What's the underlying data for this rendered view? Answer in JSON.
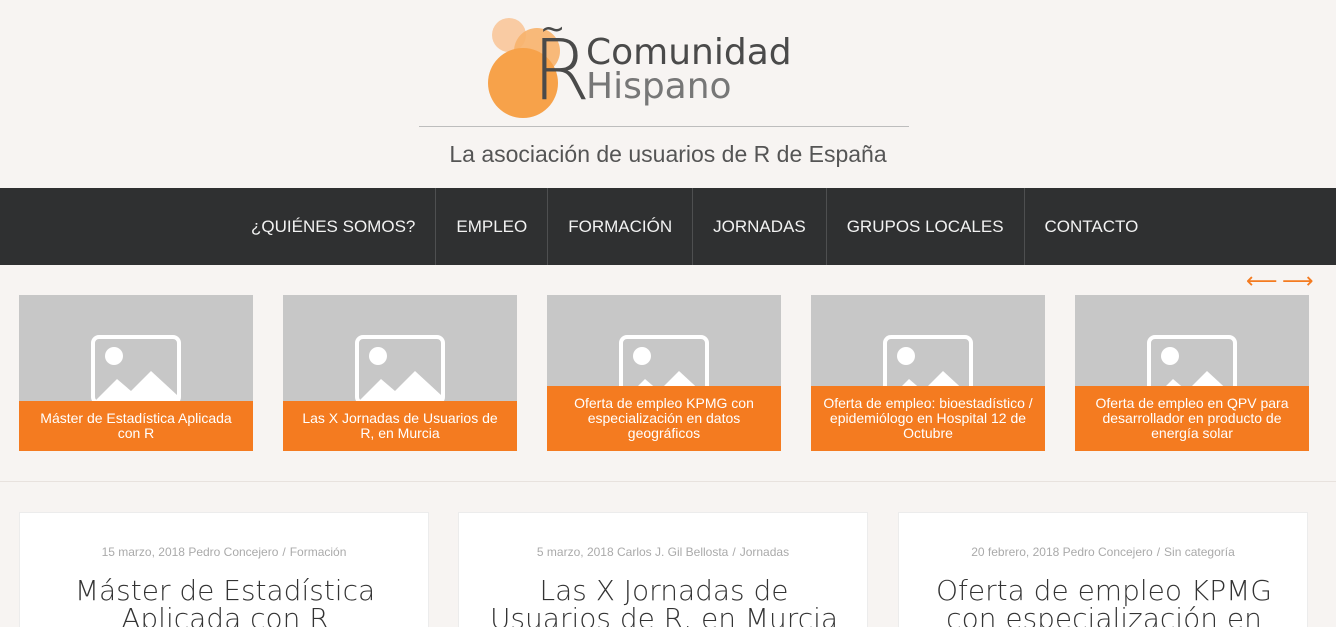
{
  "site": {
    "logo": {
      "title_line1": "Comunidad",
      "title_line2": "Hispano",
      "mark_letter": "R",
      "mark_accent": "~"
    },
    "tagline": "La asociación de usuarios de R de España"
  },
  "nav": {
    "items": [
      {
        "label": "¿QUIÉNES SOMOS?"
      },
      {
        "label": "EMPLEO"
      },
      {
        "label": "FORMACIÓN"
      },
      {
        "label": "JORNADAS"
      },
      {
        "label": "GRUPOS LOCALES"
      },
      {
        "label": "CONTACTO"
      }
    ]
  },
  "carousel": {
    "arrow_prev": "⟵",
    "arrow_next": "⟶",
    "items": [
      {
        "caption": "Máster de Estadística Aplicada con R"
      },
      {
        "caption": "Las X Jornadas de Usuarios de R, en Murcia"
      },
      {
        "caption": "Oferta de empleo KPMG con especialización en datos geográficos"
      },
      {
        "caption": "Oferta de empleo: bioestadístico / epidemiólogo en Hospital 12 de Octubre"
      },
      {
        "caption": "Oferta de empleo en QPV para desarrollador en producto de energía solar"
      }
    ]
  },
  "posts": [
    {
      "date": "15 marzo, 2018",
      "author": "Pedro Concejero",
      "category": "Formación",
      "title": "Máster de Estadística Aplicada con R"
    },
    {
      "date": "5 marzo, 2018",
      "author": "Carlos J. Gil Bellosta",
      "category": "Jornadas",
      "title": "Las X Jornadas de Usuarios de R, en Murcia"
    },
    {
      "date": "20 febrero, 2018",
      "author": "Pedro Concejero",
      "category": "Sin categoría",
      "title": "Oferta de empleo KPMG con especialización en"
    }
  ],
  "colors": {
    "accent": "#f47b20",
    "nav_bg": "#2f3031",
    "page_bg": "#f7f4f2"
  }
}
